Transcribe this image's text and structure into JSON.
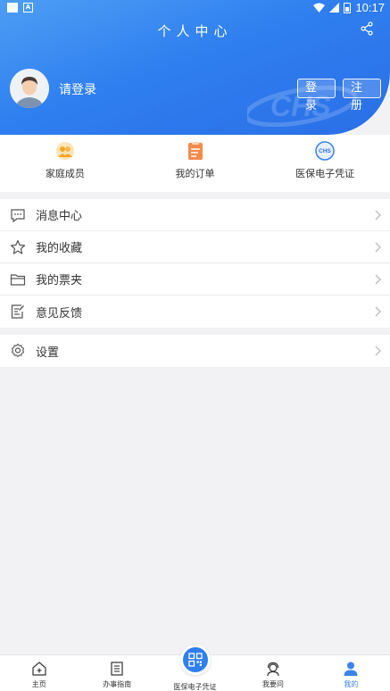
{
  "status_bar": {
    "time": "10:17",
    "badge_letter": "A"
  },
  "header": {
    "title": "个人中心",
    "watermark": "CHS",
    "login_prompt": "请登录",
    "login_label": "登录",
    "register_label": "注册"
  },
  "quick_actions": [
    {
      "label": "家庭成员",
      "icon": "family-icon"
    },
    {
      "label": "我的订单",
      "icon": "order-icon"
    },
    {
      "label": "医保电子凭证",
      "icon": "chs-badge-icon",
      "icon_text": "CHS"
    }
  ],
  "menu": [
    {
      "label": "消息中心",
      "icon": "message-icon"
    },
    {
      "label": "我的收藏",
      "icon": "star-icon"
    },
    {
      "label": "我的票夹",
      "icon": "folder-icon"
    },
    {
      "label": "意见反馈",
      "icon": "feedback-icon"
    }
  ],
  "settings": {
    "label": "设置",
    "icon": "gear-icon"
  },
  "tabbar": [
    {
      "label": "主页",
      "icon": "home-icon"
    },
    {
      "label": "办事指南",
      "icon": "guide-icon"
    },
    {
      "label": "医保电子凭证",
      "icon": "qr-icon"
    },
    {
      "label": "我要问",
      "icon": "support-icon"
    },
    {
      "label": "我的",
      "icon": "person-icon",
      "active": true
    }
  ],
  "colors": {
    "primary": "#2f7ff0",
    "tab_active": "#3b82f0",
    "background": "#f2f2f5"
  }
}
